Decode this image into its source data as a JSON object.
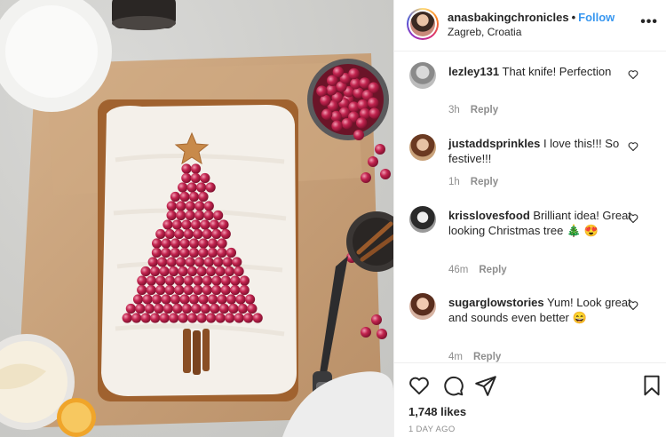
{
  "post": {
    "username": "anasbakingchronicles",
    "separator": "•",
    "follow_label": "Follow",
    "location": "Zagreb, Croatia",
    "more_icon": "more-horizontal-icon"
  },
  "comments": [
    {
      "username": "lezley131",
      "text": "That knife! Perfection",
      "time": "3h",
      "reply_label": "Reply"
    },
    {
      "username": "justaddsprinkles",
      "text": "I love this!!! So festive!!!",
      "time": "1h",
      "reply_label": "Reply"
    },
    {
      "username": "krisslovesfood",
      "text": "Brilliant idea! Great looking Christmas tree 🎄 😍",
      "time": "46m",
      "reply_label": "Reply"
    },
    {
      "username": "sugarglowstories",
      "text": "Yum! Look great and sounds even better 😄",
      "time": "4m",
      "reply_label": "Reply"
    }
  ],
  "actions": {
    "like_icon": "heart-outline-icon",
    "comment_icon": "comment-bubble-icon",
    "share_icon": "paper-plane-icon",
    "save_icon": "bookmark-icon"
  },
  "likes": "1,748 likes",
  "posted": "1 DAY AGO",
  "colors": {
    "link_blue": "#3897f0",
    "text": "#262626",
    "muted": "#8e8e8e",
    "divider": "#efefef",
    "cranberry": "#b01a42",
    "frosting": "#f4f0ea",
    "parchment": "#c9a47e"
  }
}
